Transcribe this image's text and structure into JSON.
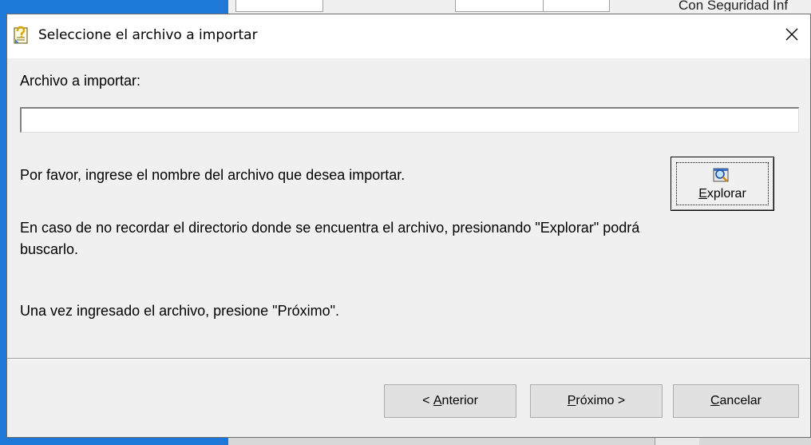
{
  "background": {
    "right_text": "Con Seguridad Inf"
  },
  "dialog": {
    "title": "Seleccione el archivo a importar",
    "icon": "question-document-icon",
    "close_icon": "close-icon"
  },
  "form": {
    "label": "Archivo a importar:",
    "file_value": "",
    "paragraph1": "Por favor, ingrese el nombre del archivo que desea importar.",
    "paragraph2": "En caso de no recordar el directorio donde se encuentra el archivo, presionando \"Explorar\" podrá buscarlo.",
    "paragraph3": "Una vez ingresado el archivo, presione \"Próximo\"."
  },
  "explorar": {
    "label_access": "E",
    "label_rest": "xplorar",
    "icon": "magnifier-icon"
  },
  "buttons": {
    "anterior_prefix": "< ",
    "anterior_access": "A",
    "anterior_rest": "nterior",
    "proximo_access": "P",
    "proximo_rest": "róximo",
    "proximo_suffix": " >",
    "cancelar_access": "C",
    "cancelar_rest": "ancelar"
  },
  "colors": {
    "background_app_blue": "#1e78d7",
    "dialog_bg": "#f0f0f0",
    "title_bar": "#ffffff"
  }
}
